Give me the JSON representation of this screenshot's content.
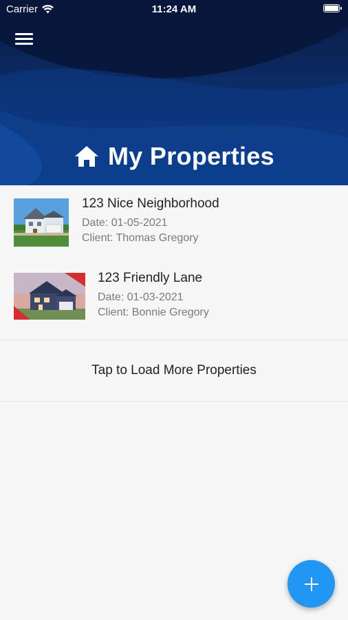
{
  "status_bar": {
    "carrier": "Carrier",
    "time": "11:24 AM"
  },
  "header": {
    "title": "My Properties",
    "icon": "home-icon",
    "menu_icon": "hamburger-menu-icon"
  },
  "properties": [
    {
      "name": "123 Nice Neighborhood",
      "date": "Date: 01-05-2021",
      "client": "Client: Thomas Gregory"
    },
    {
      "name": "123 Friendly Lane",
      "date": "Date: 01-03-2021",
      "client": "Client: Bonnie Gregory"
    }
  ],
  "load_more": "Tap to Load More Properties",
  "fab_icon": "plus-icon",
  "colors": {
    "header_dark": "#0a1a3f",
    "header_blue": "#0b3b86",
    "fab": "#2196f3",
    "background": "#f6f6f7"
  }
}
